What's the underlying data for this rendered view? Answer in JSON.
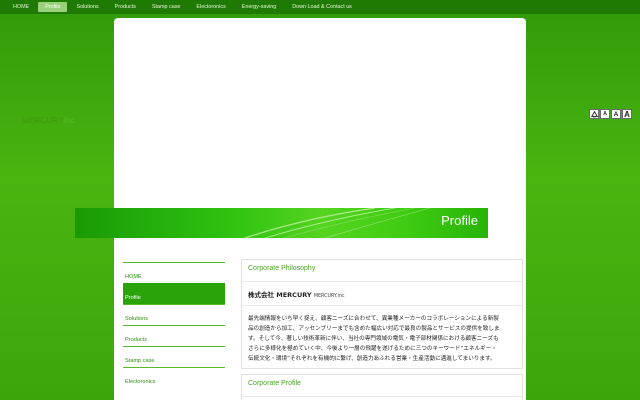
{
  "nav": {
    "items": [
      {
        "label": "HOME",
        "active": false
      },
      {
        "label": "Profile",
        "active": true
      },
      {
        "label": "Solutions",
        "active": false
      },
      {
        "label": "Products",
        "active": false
      },
      {
        "label": "Stamp case",
        "active": false
      },
      {
        "label": "Electoronics",
        "active": false
      },
      {
        "label": "Energy-saving",
        "active": false
      },
      {
        "label": "Down Load & Contact us",
        "active": false
      }
    ]
  },
  "logo": {
    "main": "MERCURY",
    "suffix": "Inc"
  },
  "font_controls": {
    "small": "A",
    "medium": "A",
    "large": "A"
  },
  "banner": {
    "title": "Profile"
  },
  "side_menu": {
    "items": [
      {
        "label": "HOME",
        "active": false
      },
      {
        "label": "Profile",
        "active": true
      },
      {
        "label": "Solutions",
        "active": false
      },
      {
        "label": "Products",
        "active": false
      },
      {
        "label": "Stamp case",
        "active": false
      },
      {
        "label": "Electoronics",
        "active": false
      }
    ]
  },
  "content": {
    "philosophy_heading": "Corporate Philosophy",
    "company_name": "株式会社 MERCURY",
    "company_sub": "MERCURY.inc",
    "body_lines": [
      "最先端情報をいち早く捉え、顧客ニーズに合わせて、異業種メーカーのコラボレーションによる新製",
      "品の創造から加工、アッセンブリーまでも含めた幅広い対応で最良の製品とサービスの提供を致しま",
      "す。そして今、著しい技術革新に伴い、当社の専門領域の電気・電子部材関係における顧客ニーズも",
      "さらに多様化を極めていく中、今後より一層の飛躍を遂げるために三つのキーワード“エネルギー・",
      "伝統文化・環境”それぞれを有機的に繋げ、創造力あふれる営業・生産活動に邁進してまいります。"
    ],
    "profile_heading": "Corporate Profile"
  }
}
